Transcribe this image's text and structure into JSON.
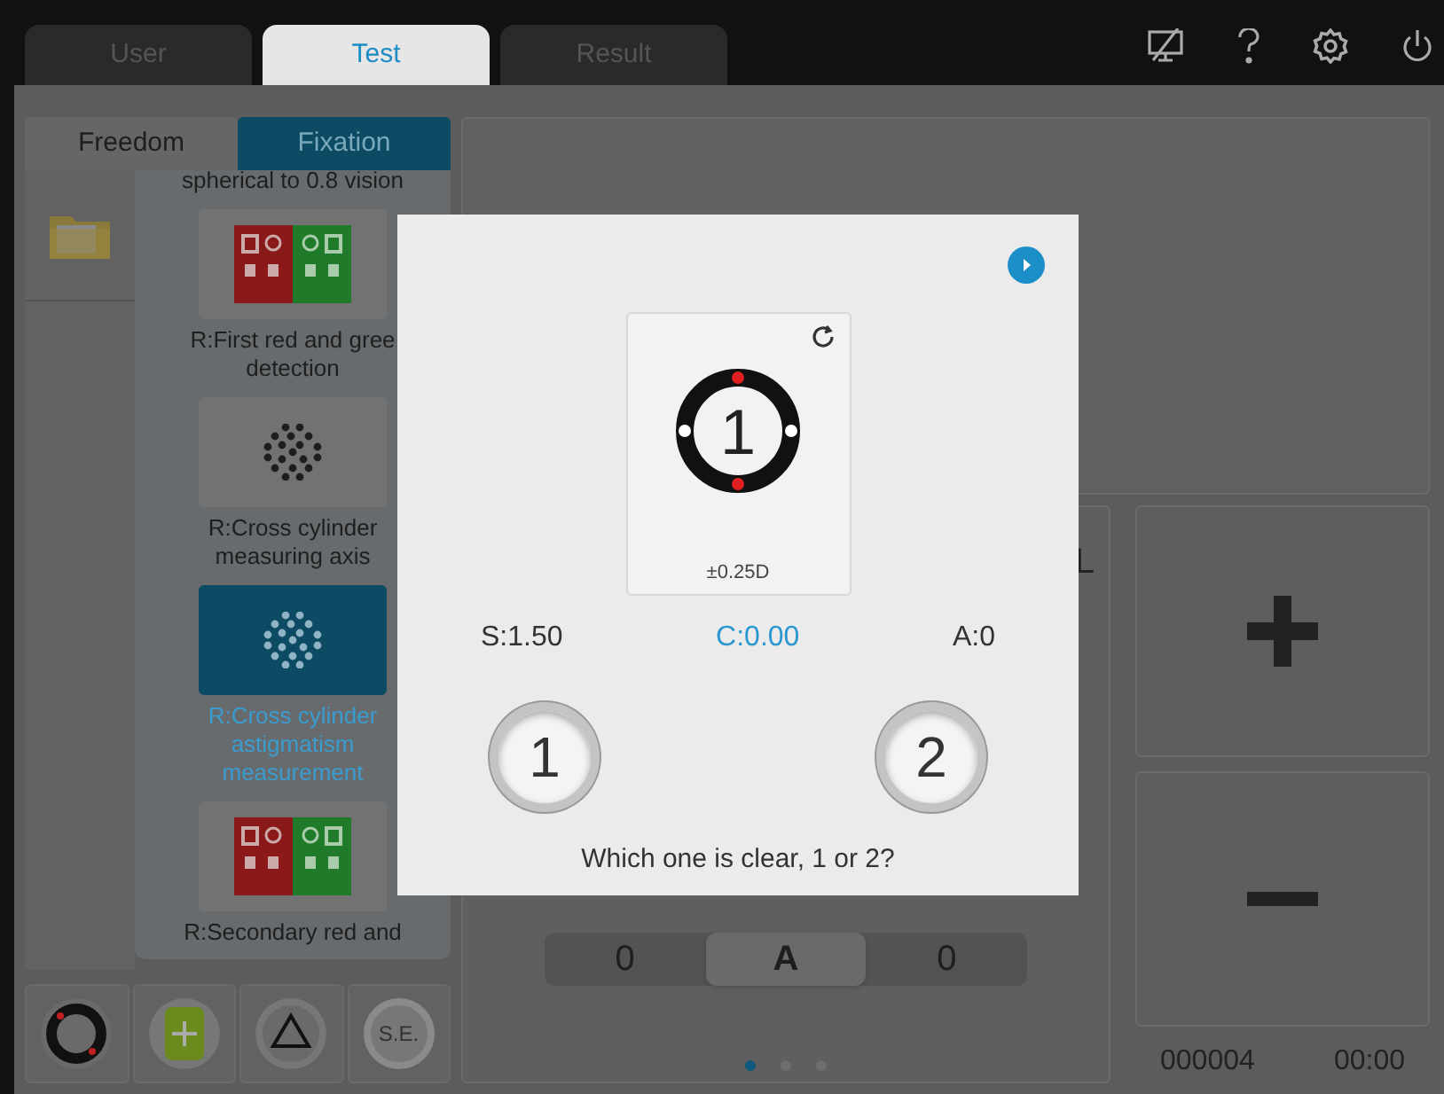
{
  "tabs": [
    {
      "label": "User",
      "selected": false
    },
    {
      "label": "Test",
      "selected": true
    },
    {
      "label": "Result",
      "selected": false
    }
  ],
  "mode_tabs": [
    {
      "label": "Freedom",
      "selected": false
    },
    {
      "label": "Fixation",
      "selected": true
    }
  ],
  "programs": [
    {
      "kind": "caption",
      "label": "spherical to 0.8 vision",
      "selected": false
    },
    {
      "kind": "red_green",
      "label": "R:First red and gree detection",
      "selected": false
    },
    {
      "kind": "dots",
      "label": "R:Cross cylinder measuring axis",
      "selected": false
    },
    {
      "kind": "dots",
      "label": "R:Cross cylinder astigmatism measurement",
      "selected": true
    },
    {
      "kind": "red_green",
      "label": "R:Secondary red and",
      "selected": false
    }
  ],
  "tools": [
    {
      "kind": "ring"
    },
    {
      "kind": "plus"
    },
    {
      "kind": "triangle"
    },
    {
      "kind": "text",
      "label": "S.E."
    }
  ],
  "main": {
    "eye_label": "L",
    "axis_row": [
      {
        "label": "0",
        "selected": false
      },
      {
        "label": "A",
        "selected": true
      },
      {
        "label": "0",
        "selected": false
      }
    ],
    "page_dots": [
      {
        "selected": true
      },
      {
        "selected": false
      },
      {
        "selected": false
      }
    ]
  },
  "status": {
    "counter": "000004",
    "time": "00:00"
  },
  "dialog": {
    "chart_number": "1",
    "chart_label": "±0.25D",
    "readings": [
      {
        "label": "S:1.50",
        "selected": false
      },
      {
        "label": "C:0.00",
        "selected": true
      },
      {
        "label": "A:0",
        "selected": false
      }
    ],
    "choices": [
      "1",
      "2"
    ],
    "question": "Which one is clear, 1 or 2?"
  }
}
